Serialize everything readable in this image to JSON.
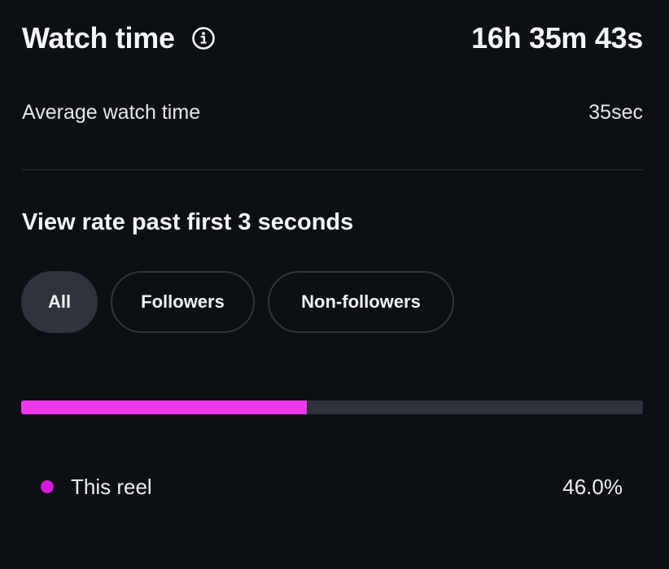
{
  "header": {
    "title": "Watch time",
    "info_icon": "info-icon",
    "total_watch_time": "16h 35m 43s"
  },
  "average": {
    "label": "Average watch time",
    "value": "35sec"
  },
  "view_rate": {
    "title": "View rate past first 3 seconds",
    "filters": [
      {
        "label": "All",
        "selected": true
      },
      {
        "label": "Followers",
        "selected": false
      },
      {
        "label": "Non-followers",
        "selected": false
      }
    ],
    "progress_fraction": 0.46,
    "legend": {
      "label": "This reel",
      "value": "46.0%",
      "color": "#d41ad8"
    }
  },
  "colors": {
    "background": "#0c0f14",
    "bar_fill": "#ed38ee",
    "bar_track": "#2f323a",
    "chip_active_bg": "#2f333b"
  }
}
